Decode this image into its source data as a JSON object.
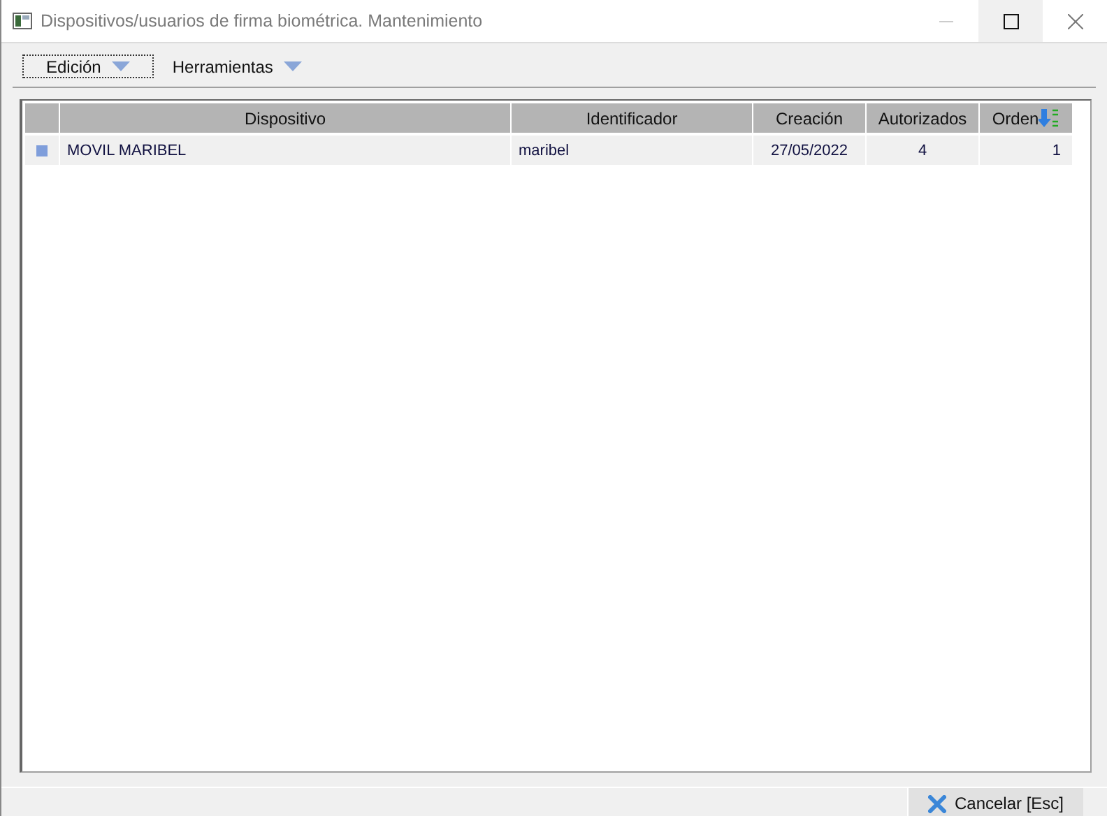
{
  "window": {
    "title": "Dispositivos/usuarios de firma biométrica. Mantenimiento"
  },
  "menus": [
    {
      "label": "Edición",
      "focused": true
    },
    {
      "label": "Herramientas",
      "focused": false
    }
  ],
  "table": {
    "columns": [
      {
        "label": "Dispositivo",
        "sorted": false
      },
      {
        "label": "Identificador",
        "sorted": false
      },
      {
        "label": "Creación",
        "sorted": false
      },
      {
        "label": "Autorizados",
        "sorted": false
      },
      {
        "label": "Orden",
        "sorted": true
      }
    ],
    "rows": [
      {
        "selected": true,
        "cells": [
          "MOVIL MARIBEL",
          "maribel",
          "27/05/2022",
          "4",
          "1"
        ]
      }
    ]
  },
  "buttons": [
    {
      "label": "Cancelar [Esc]"
    }
  ]
}
